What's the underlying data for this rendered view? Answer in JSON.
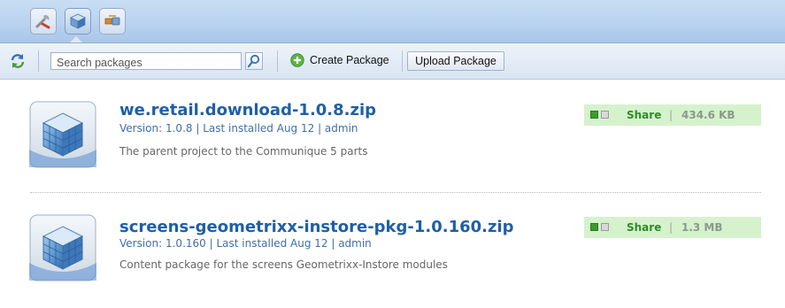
{
  "toolbar": {
    "search_placeholder": "Search packages",
    "create_label": "Create Package",
    "upload_label": "Upload Package"
  },
  "top_tools": [
    {
      "icon": "tools-icon",
      "active": false
    },
    {
      "icon": "package-icon",
      "active": true
    },
    {
      "icon": "replicate-icon",
      "active": false
    }
  ],
  "packages": [
    {
      "name": "we.retail.download-1.0.8.zip",
      "meta": "Version: 1.0.8 | Last installed Aug 12 | admin",
      "description": "The parent project to the Communique 5 parts",
      "share_label": "Share",
      "separator": "|",
      "size": "434.6 KB"
    },
    {
      "name": "screens-geometrixx-instore-pkg-1.0.160.zip",
      "meta": "Version: 1.0.160 | Last installed Aug 12 | admin",
      "description": "Content package for the screens Geometrixx-Instore modules",
      "share_label": "Share",
      "separator": "|",
      "size": "1.3 MB"
    }
  ],
  "colors": {
    "package_name": "#1f5fa6",
    "share_background": "#d5f2cd",
    "share_text": "#2f8a2a",
    "topbar": "#bcd5f0"
  }
}
